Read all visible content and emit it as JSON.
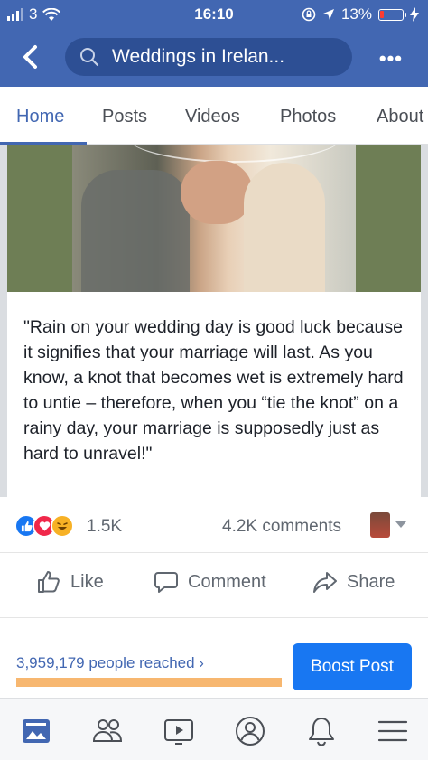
{
  "status_bar": {
    "carrier": "3",
    "time": "16:10",
    "battery": "13%"
  },
  "navbar": {
    "search_text": "Weddings in Irelan...",
    "more": "•••"
  },
  "tabs": [
    {
      "label": "Home",
      "active": true
    },
    {
      "label": "Posts"
    },
    {
      "label": "Videos"
    },
    {
      "label": "Photos"
    },
    {
      "label": "About"
    }
  ],
  "post": {
    "quote": "\"Rain on your wedding day is good luck because it signifies that your marriage will last. As you know, a knot that becomes wet is extremely hard to untie – therefore, when you “tie the knot” on a rainy day, your marriage is supposedly just as hard to unravel!\"",
    "reaction_count": "1.5K",
    "comments_count": "4.2K comments",
    "actions": {
      "like": "Like",
      "comment": "Comment",
      "share": "Share"
    }
  },
  "boost": {
    "reached": "3,959,179 people reached",
    "button": "Boost Post"
  },
  "colors": {
    "brand": "#4267b2",
    "boost_button": "#1877f2",
    "reach_bar": "#f7b770"
  }
}
